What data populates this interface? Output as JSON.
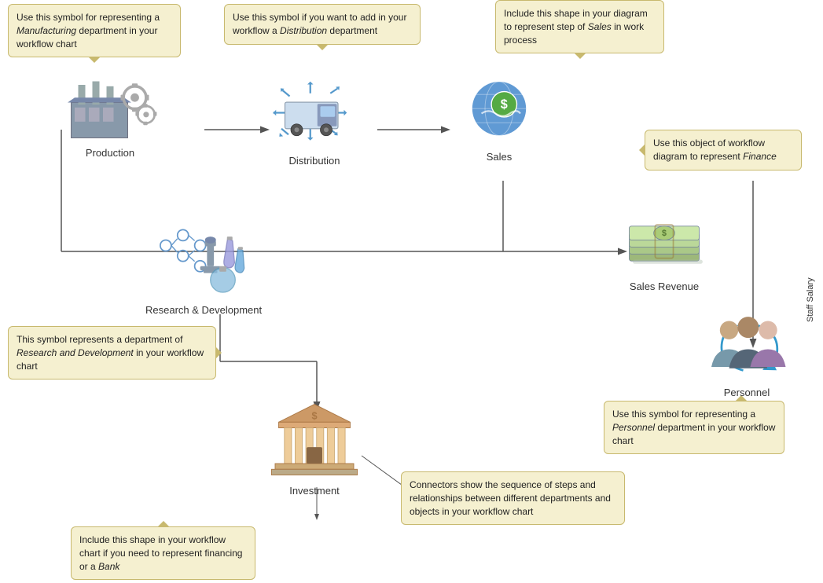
{
  "tooltips": {
    "manufacturing": {
      "text": "Use this symbol for representing a ",
      "italic": "Manufacturing",
      "text2": " department in your workflow chart"
    },
    "distribution": {
      "text": "Use this symbol if you want to add in your workflow a ",
      "italic": "Distribution",
      "text2": " department"
    },
    "sales": {
      "text": "Include this shape in your diagram to represent step of ",
      "italic": "Sales",
      "text2": " in work process"
    },
    "finance": {
      "text": "Use this object of workflow diagram to represent ",
      "italic": "Finance"
    },
    "rd": {
      "text": "This symbol represents a department of ",
      "italic": "Research and Development",
      "text2": " in your workflow chart"
    },
    "personnel": {
      "text": "Use this symbol for representing a ",
      "italic": "Personnel",
      "text2": " department in your workflow chart"
    },
    "bank": {
      "text": "Include this shape in your workflow chart if you need to represent financing or a ",
      "italic": "Bank"
    },
    "connectors": {
      "text": "Connectors show the sequence of steps and relationships between different departments and objects in your workflow chart"
    }
  },
  "nodes": {
    "production": {
      "label": "Production"
    },
    "distribution": {
      "label": "Distribution"
    },
    "sales": {
      "label": "Sales"
    },
    "salesRevenue": {
      "label": "Sales Revenue"
    },
    "rd": {
      "label": "Research & Development"
    },
    "investment": {
      "label": "Investment"
    },
    "personnel": {
      "label": "Personnel"
    },
    "staffSalary": {
      "label": "Staff Salary"
    }
  }
}
